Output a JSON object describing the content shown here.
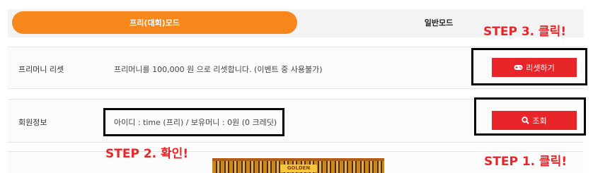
{
  "tabs": [
    {
      "label": "프리(대회)모드",
      "active": true
    },
    {
      "label": "일반모드",
      "active": false
    }
  ],
  "rows": {
    "reset": {
      "label": "프리머니 리셋",
      "description": "프리머니를 100,000 원 으로 리셋합니다. (이벤트 중 사용불가)",
      "button_label": "리셋하기",
      "button_icon": "gamepad-icon"
    },
    "member": {
      "label": "회원정보",
      "description": "아이디 : time (프리) / 보유머니 : 0원 (0 크레딧)",
      "button_label": "조회",
      "button_icon": "search-icon"
    }
  },
  "annotations": {
    "step3": "STEP 3. 클릭!",
    "step2": "STEP 2. 확인!",
    "step1": "STEP 1. 클릭!"
  },
  "banner": {
    "label": "GOLDEN"
  },
  "colors": {
    "accent_orange": "#f7861b",
    "button_red": "#e8262a",
    "step_red": "#e8262a",
    "tab_bg": "#f3f3f3"
  }
}
